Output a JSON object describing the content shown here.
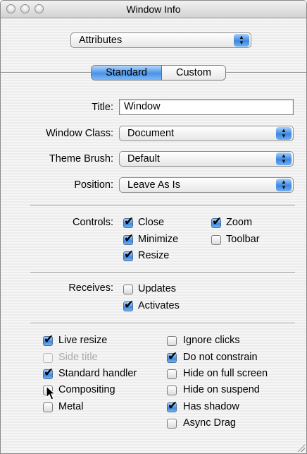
{
  "window": {
    "title": "Window Info"
  },
  "attributes_popup": {
    "value": "Attributes"
  },
  "segmented": {
    "standard": "Standard",
    "custom": "Custom",
    "selected": "Standard"
  },
  "fields": {
    "title_label": "Title:",
    "title_value": "Window",
    "window_class_label": "Window Class:",
    "window_class_value": "Document",
    "theme_brush_label": "Theme Brush:",
    "theme_brush_value": "Default",
    "position_label": "Position:",
    "position_value": "Leave As Is"
  },
  "controls": {
    "label": "Controls:",
    "items": [
      {
        "label": "Close",
        "checked": true
      },
      {
        "label": "Minimize",
        "checked": true
      },
      {
        "label": "Resize",
        "checked": true
      },
      {
        "label": "Zoom",
        "checked": true
      },
      {
        "label": "Toolbar",
        "checked": false
      }
    ]
  },
  "receives": {
    "label": "Receives:",
    "items": [
      {
        "label": "Updates",
        "checked": false
      },
      {
        "label": "Activates",
        "checked": true
      }
    ]
  },
  "options_left": [
    {
      "label": "Live resize",
      "checked": true
    },
    {
      "label": "Side title",
      "checked": false,
      "disabled": true
    },
    {
      "label": "Standard handler",
      "checked": true
    },
    {
      "label": "Compositing",
      "checked": false
    },
    {
      "label": "Metal",
      "checked": false
    }
  ],
  "options_right": [
    {
      "label": "Ignore clicks",
      "checked": false
    },
    {
      "label": "Do not constrain",
      "checked": true
    },
    {
      "label": "Hide on full screen",
      "checked": false
    },
    {
      "label": "Hide on suspend",
      "checked": false
    },
    {
      "label": "Has shadow",
      "checked": true
    },
    {
      "label": "Async Drag",
      "checked": false
    }
  ]
}
